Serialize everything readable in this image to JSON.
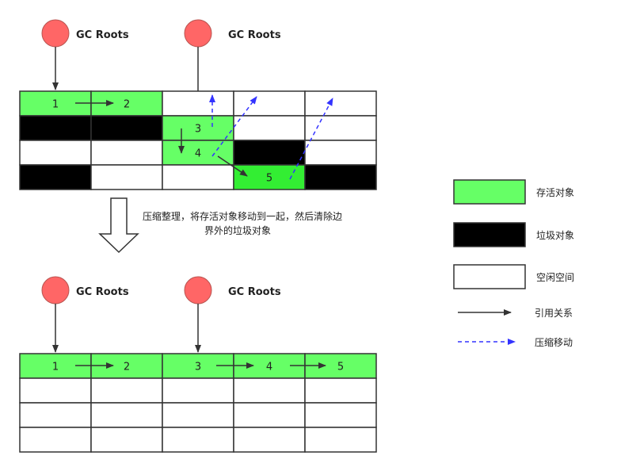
{
  "before": {
    "roots": [
      "GC Roots",
      "GC Roots"
    ],
    "grid": [
      [
        "live",
        "live",
        "free",
        "free",
        "free"
      ],
      [
        "garbage",
        "garbage",
        "live",
        "free",
        "free"
      ],
      [
        "free",
        "free",
        "live",
        "garbage",
        "free"
      ],
      [
        "garbage",
        "free",
        "free",
        "live-bright",
        "garbage"
      ]
    ],
    "labels": [
      {
        "row": 0,
        "col": 0,
        "text": "1"
      },
      {
        "row": 0,
        "col": 1,
        "text": "2"
      },
      {
        "row": 1,
        "col": 2,
        "text": "3"
      },
      {
        "row": 2,
        "col": 2,
        "text": "4"
      },
      {
        "row": 3,
        "col": 3,
        "text": "5"
      }
    ]
  },
  "caption": {
    "line1": "压缩整理，将存活对象移动到一起，然后清除边",
    "line2": "界外的垃圾对象"
  },
  "after": {
    "roots": [
      "GC Roots",
      "GC Roots"
    ],
    "grid": [
      [
        "live",
        "live",
        "live",
        "live",
        "live"
      ],
      [
        "free",
        "free",
        "free",
        "free",
        "free"
      ],
      [
        "free",
        "free",
        "free",
        "free",
        "free"
      ],
      [
        "free",
        "free",
        "free",
        "free",
        "free"
      ]
    ],
    "labels": [
      {
        "row": 0,
        "col": 0,
        "text": "1"
      },
      {
        "row": 0,
        "col": 1,
        "text": "2"
      },
      {
        "row": 0,
        "col": 2,
        "text": "3"
      },
      {
        "row": 0,
        "col": 3,
        "text": "4"
      },
      {
        "row": 0,
        "col": 4,
        "text": "5"
      }
    ]
  },
  "legend": {
    "live": "存活对象",
    "garbage": "垃圾对象",
    "free": "空闲空间",
    "reference": "引用关系",
    "compact_move": "压缩移动"
  },
  "colors": {
    "live": "#66ff66",
    "live_bright": "#33ee33",
    "garbage": "#000000",
    "free": "#ffffff",
    "root": "#ff6666",
    "move_arrow": "#3333ff",
    "ref_arrow": "#333333"
  }
}
